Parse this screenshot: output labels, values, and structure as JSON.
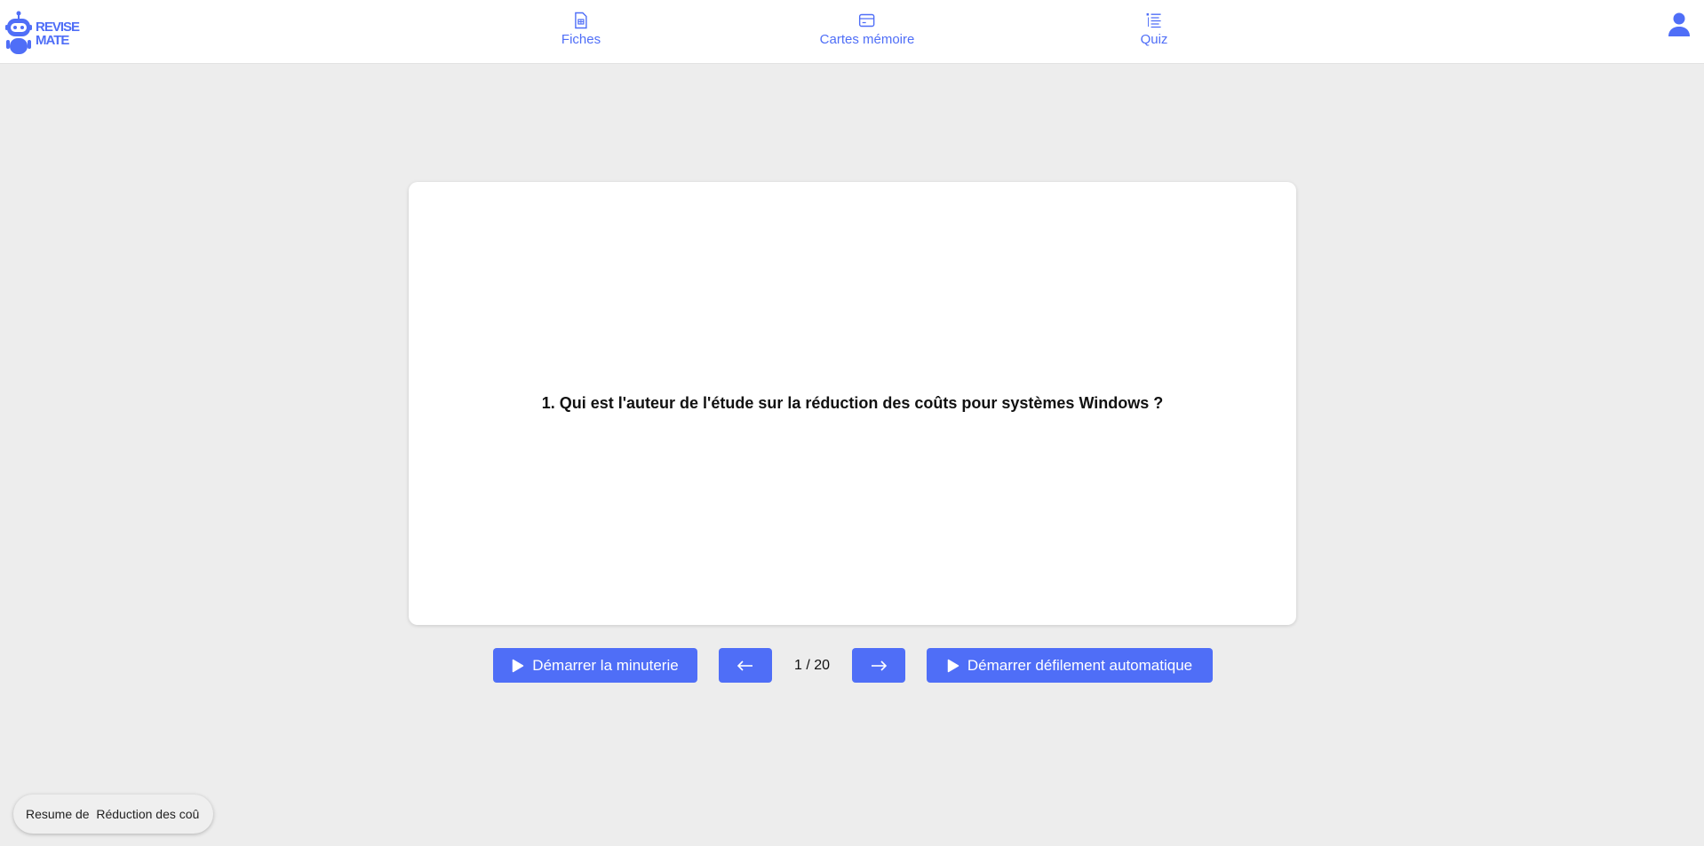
{
  "brand": {
    "line1": "REVISE",
    "line2": "MATE",
    "color": "#4f6ef7"
  },
  "nav": {
    "items": [
      {
        "label": "Fiches",
        "icon": "document-icon"
      },
      {
        "label": "Cartes mémoire",
        "icon": "card-icon"
      },
      {
        "label": "Quiz",
        "icon": "list-icon"
      }
    ],
    "user_icon": "user-icon"
  },
  "flashcard": {
    "question": "1. Qui est l'auteur de l'étude sur la réduction des coûts pour systèmes Windows ?"
  },
  "controls": {
    "timer_label": "Démarrer la minuterie",
    "prev_icon": "arrow-left-icon",
    "counter": "1 / 20",
    "next_icon": "arrow-right-icon",
    "autoscroll_label": "Démarrer défilement automatique"
  },
  "resume": {
    "label": "Resume de  Réduction des coû"
  },
  "colors": {
    "accent": "#4f6ef7",
    "background": "#ededed",
    "card": "#ffffff"
  }
}
